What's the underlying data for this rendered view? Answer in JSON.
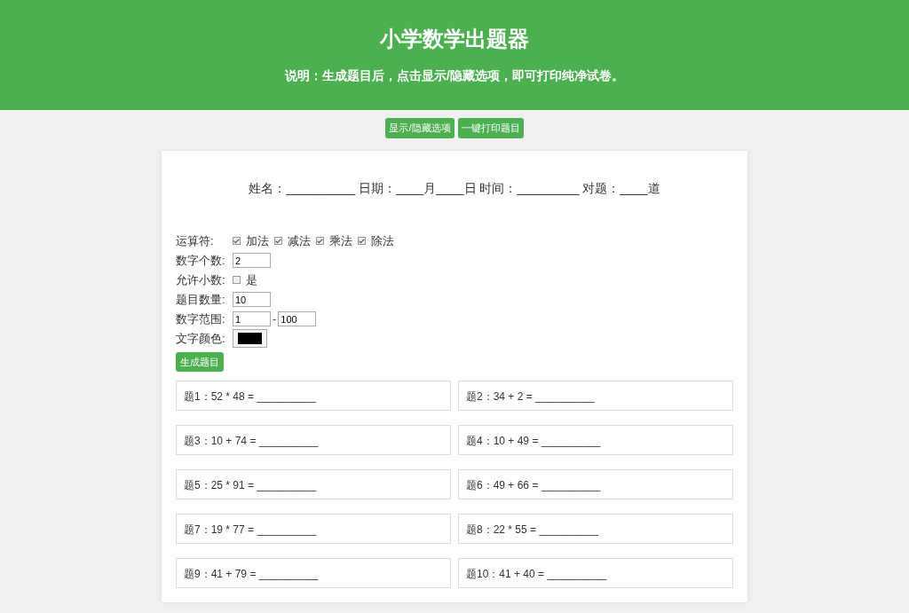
{
  "header": {
    "title": "小学数学出题器",
    "note": "说明：生成题目后，点击显示/隐藏选项，即可打印纯净试卷。"
  },
  "top_buttons": [
    "显示/隐藏选项",
    "一键打印题目"
  ],
  "sheet_line": "姓名：__________ 日期：____月____日 时间：_________ 对题：____道",
  "options": [
    {
      "kind": "checks",
      "label": "运算符:",
      "items": [
        {
          "label": "加法",
          "checked": true
        },
        {
          "label": "减法",
          "checked": true
        },
        {
          "label": "乘法",
          "checked": true
        },
        {
          "label": "除法",
          "checked": true
        }
      ]
    },
    {
      "kind": "input",
      "label": "数字个数:",
      "value": "2"
    },
    {
      "kind": "checks",
      "label": "允许小数:",
      "items": [
        {
          "label": "是",
          "checked": false
        }
      ]
    },
    {
      "kind": "input",
      "label": "题目数量:",
      "value": "10"
    },
    {
      "kind": "range",
      "label": "数字范围:",
      "from": "1",
      "separator": "-",
      "to": "100"
    },
    {
      "kind": "color",
      "label": "文字颜色:",
      "color": "#000000"
    }
  ],
  "generate_button": "生成题目",
  "questions": [
    "题1：52 * 48 = __________",
    "题2：34 + 2 = __________",
    "题3：10 + 74 = __________",
    "题4：10 + 49 = __________",
    "题5：25 * 91 = __________",
    "题6：49 + 66 = __________",
    "题7：19 * 77 = __________",
    "题8：22 * 55 = __________",
    "题9：41 + 79 = __________",
    "题10：41 + 40 = __________"
  ]
}
